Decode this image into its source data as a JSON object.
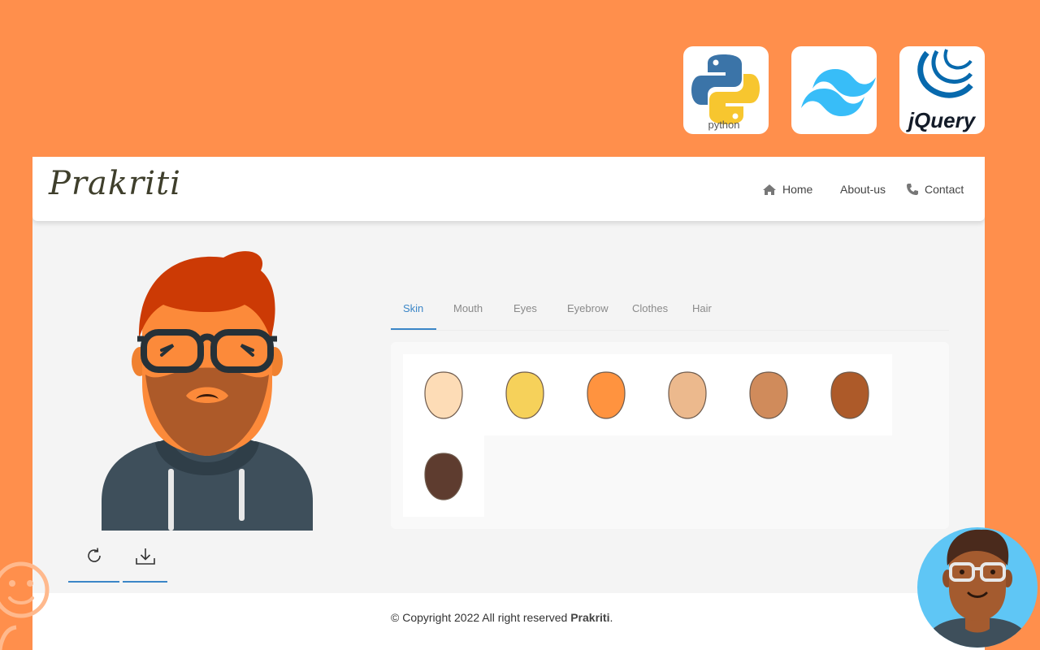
{
  "badges": {
    "python_label": "python",
    "jquery_label": "jQuery"
  },
  "nav": {
    "logo": "Prakriti",
    "links": [
      {
        "label": "Home",
        "icon": "home-icon"
      },
      {
        "label": "About-us"
      },
      {
        "label": "Contact",
        "icon": "phone-icon"
      }
    ]
  },
  "tabs": [
    {
      "label": "Skin",
      "active": true
    },
    {
      "label": "Mouth"
    },
    {
      "label": "Eyes"
    },
    {
      "label": "Eyebrow"
    },
    {
      "label": "Clothes"
    },
    {
      "label": "Hair"
    }
  ],
  "skin_swatches": [
    "#fddcb6",
    "#f6d15a",
    "#ff933f",
    "#ecb98d",
    "#d08b5b",
    "#ad5a29",
    "#5e3c2f"
  ],
  "actions": {
    "refresh_icon": "refresh-icon",
    "download_icon": "download-icon"
  },
  "footer": {
    "copyright_text": "© Copyright 2022 All right reserved",
    "brand": "Prakriti",
    "end": "."
  },
  "colors": {
    "background": "#ff8f4c",
    "accent": "#3b86c7",
    "hair": "#cc3a05",
    "beard": "#ad5a29",
    "hoodie": "#3e4f5b"
  }
}
